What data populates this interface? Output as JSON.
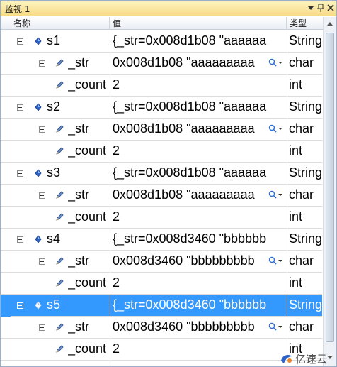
{
  "window": {
    "title": "监视 1"
  },
  "columns": {
    "name": "名称",
    "value": "值",
    "type": "类型"
  },
  "rows": [
    {
      "name": "s1",
      "value": "{_str=0x008d1b08 \"aaaaaa",
      "type": "String",
      "expander": "minus",
      "icon": "diamond-icon"
    },
    {
      "name": "_str",
      "value": "0x008d1b08 \"aaaaaaaaa",
      "type": "char",
      "expander": "plus",
      "icon": "pencil-icon"
    },
    {
      "name": "_count",
      "value": "2",
      "type": "int",
      "expander": "",
      "icon": "pencil-icon"
    },
    {
      "name": "s2",
      "value": "{_str=0x008d1b08 \"aaaaaa",
      "type": "String",
      "expander": "minus",
      "icon": "diamond-icon"
    },
    {
      "name": "_str",
      "value": "0x008d1b08 \"aaaaaaaaa",
      "type": "char",
      "expander": "plus",
      "icon": "pencil-icon"
    },
    {
      "name": "_count",
      "value": "2",
      "type": "int",
      "expander": "",
      "icon": "pencil-icon"
    },
    {
      "name": "s3",
      "value": "{_str=0x008d1b08 \"aaaaaa",
      "type": "String",
      "expander": "minus",
      "icon": "diamond-icon"
    },
    {
      "name": "_str",
      "value": "0x008d1b08 \"aaaaaaaaa",
      "type": "char",
      "expander": "plus",
      "icon": "pencil-icon"
    },
    {
      "name": "_count",
      "value": "2",
      "type": "int",
      "expander": "",
      "icon": "pencil-icon"
    },
    {
      "name": "s4",
      "value": "{_str=0x008d3460 \"bbbbbb",
      "type": "String",
      "expander": "minus",
      "icon": "diamond-icon"
    },
    {
      "name": "_str",
      "value": "0x008d3460 \"bbbbbbbbb",
      "type": "char",
      "expander": "plus",
      "icon": "pencil-icon"
    },
    {
      "name": "_count",
      "value": "2",
      "type": "int",
      "expander": "",
      "icon": "pencil-icon"
    },
    {
      "name": "s5",
      "value": "{_str=0x008d3460 \"bbbbbb",
      "type": "String",
      "expander": "minus",
      "icon": "diamond-icon",
      "selected": true
    },
    {
      "name": "_str",
      "value": "0x008d3460 \"bbbbbbbbb",
      "type": "char",
      "expander": "plus",
      "icon": "pencil-icon"
    },
    {
      "name": "_count",
      "value": "2",
      "type": "int",
      "expander": "",
      "icon": "pencil-icon"
    }
  ],
  "watermark": {
    "text": "亿速云"
  },
  "colors": {
    "selection": "#3399ff",
    "titlebar": "#f7dc86",
    "icon_blue": "#2a62c9"
  }
}
